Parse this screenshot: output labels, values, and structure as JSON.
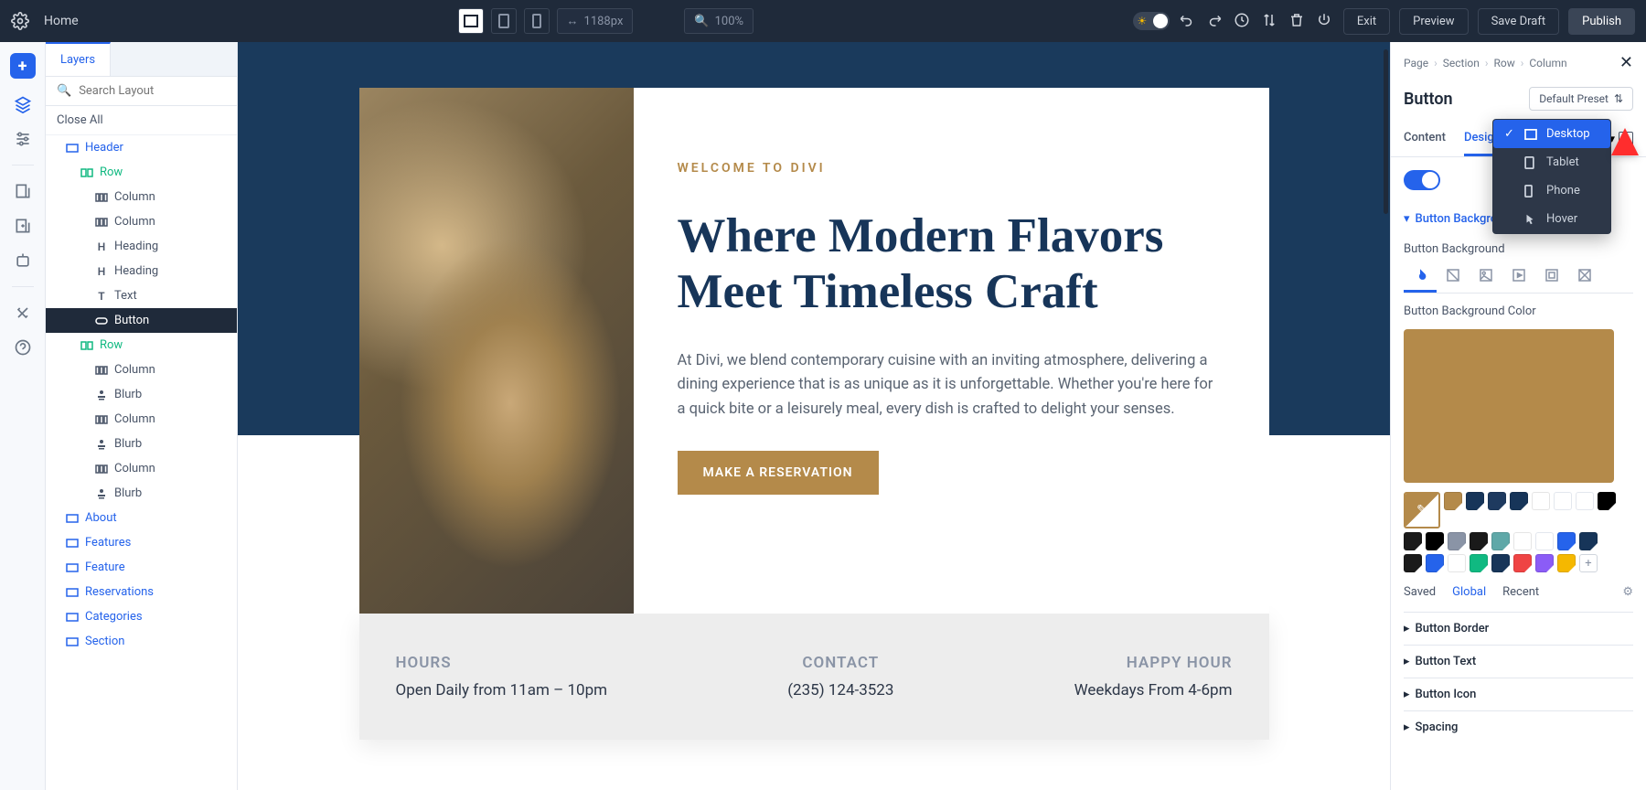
{
  "topbar": {
    "home": "Home",
    "width_value": "1188px",
    "zoom_value": "100%",
    "exit": "Exit",
    "preview": "Preview",
    "save_draft": "Save Draft",
    "publish": "Publish"
  },
  "layers": {
    "tab": "Layers",
    "search_placeholder": "Search Layout",
    "close_all": "Close All",
    "items": [
      {
        "label": "Header",
        "type": "section",
        "color": "blue",
        "pad": 1,
        "icon": "section"
      },
      {
        "label": "Row",
        "type": "row",
        "color": "green",
        "pad": 2,
        "icon": "row"
      },
      {
        "label": "Column",
        "type": "col",
        "color": "gray",
        "pad": 3,
        "icon": "col"
      },
      {
        "label": "Column",
        "type": "col",
        "color": "gray",
        "pad": 3,
        "icon": "col"
      },
      {
        "label": "Heading",
        "type": "mod",
        "color": "gray",
        "pad": 3,
        "icon": "H"
      },
      {
        "label": "Heading",
        "type": "mod",
        "color": "gray",
        "pad": 3,
        "icon": "H"
      },
      {
        "label": "Text",
        "type": "mod",
        "color": "gray",
        "pad": 3,
        "icon": "T"
      },
      {
        "label": "Button",
        "type": "mod",
        "color": "selected",
        "pad": 3,
        "icon": "btn"
      },
      {
        "label": "Row",
        "type": "row",
        "color": "green",
        "pad": 2,
        "icon": "row"
      },
      {
        "label": "Column",
        "type": "col",
        "color": "gray",
        "pad": 3,
        "icon": "col"
      },
      {
        "label": "Blurb",
        "type": "mod",
        "color": "gray",
        "pad": 3,
        "icon": "blurb"
      },
      {
        "label": "Column",
        "type": "col",
        "color": "gray",
        "pad": 3,
        "icon": "col"
      },
      {
        "label": "Blurb",
        "type": "mod",
        "color": "gray",
        "pad": 3,
        "icon": "blurb"
      },
      {
        "label": "Column",
        "type": "col",
        "color": "gray",
        "pad": 3,
        "icon": "col"
      },
      {
        "label": "Blurb",
        "type": "mod",
        "color": "gray",
        "pad": 3,
        "icon": "blurb"
      },
      {
        "label": "About",
        "type": "section",
        "color": "blue",
        "pad": 1,
        "icon": "section"
      },
      {
        "label": "Features",
        "type": "section",
        "color": "blue",
        "pad": 1,
        "icon": "section"
      },
      {
        "label": "Feature",
        "type": "section",
        "color": "blue",
        "pad": 1,
        "icon": "section"
      },
      {
        "label": "Reservations",
        "type": "section",
        "color": "blue",
        "pad": 1,
        "icon": "section"
      },
      {
        "label": "Categories",
        "type": "section",
        "color": "blue",
        "pad": 1,
        "icon": "section"
      },
      {
        "label": "Section",
        "type": "section",
        "color": "blue",
        "pad": 1,
        "icon": "section"
      }
    ]
  },
  "canvas": {
    "welcome": "WELCOME TO DIVI",
    "headline": "Where Modern Flavors Meet Timeless Craft",
    "body": "At Divi, we blend contemporary cuisine with an inviting atmosphere, delivering a dining experience that is as unique as it is unforgettable. Whether you're here for a quick bite or a leisurely meal, every dish is crafted to delight your senses.",
    "cta": "MAKE A RESERVATION",
    "info": {
      "hours_h": "HOURS",
      "hours_v": "Open Daily from 11am – 10pm",
      "contact_h": "CONTACT",
      "contact_v": "(235) 124-3523",
      "happy_h": "HAPPY HOUR",
      "happy_v": "Weekdays From 4-6pm"
    }
  },
  "settings": {
    "breadcrumb": [
      "Page",
      "Section",
      "Row",
      "Column"
    ],
    "title": "Button",
    "preset": "Default Preset",
    "tabs": {
      "content": "Content",
      "design": "Design"
    },
    "section_button_bg": "Button Background",
    "label_button_bg": "Button Background",
    "label_button_bg_color": "Button Background Color",
    "color_tabs": {
      "saved": "Saved",
      "global": "Global",
      "recent": "Recent"
    },
    "collapsed": {
      "border": "Button Border",
      "text": "Button Text",
      "icon": "Button Icon",
      "spacing": "Spacing"
    },
    "swatches_row1": [
      "#b48a4a",
      "#173559",
      "#1e3a5f",
      "#173559",
      "#ffffff",
      "",
      "",
      "#000000",
      "#1a1a1a"
    ],
    "swatches_row2": [
      "#000000",
      "#8a94a6",
      "#1a1a1a",
      "#5fa8a8",
      "#ffffff",
      "",
      "#2563eb",
      "#173559"
    ],
    "swatches_row3": [
      "#1a1a1a",
      "#2563eb",
      "#ffffff",
      "#10b981",
      "#173559",
      "#ef4444",
      "#8b5cf6",
      "#f5b800"
    ],
    "active_color": "#b48a4a"
  },
  "responsive_menu": {
    "desktop": "Desktop",
    "tablet": "Tablet",
    "phone": "Phone",
    "hover": "Hover"
  }
}
